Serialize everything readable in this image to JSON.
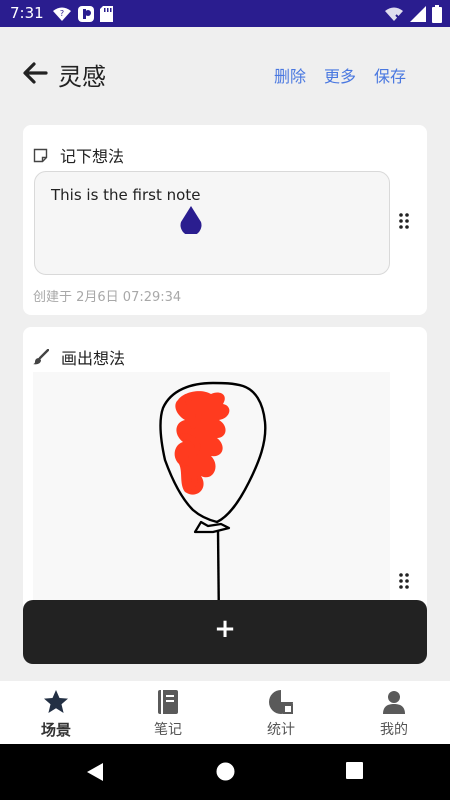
{
  "status_bar": {
    "time": "7:31",
    "left_icons": [
      "wifi-question-icon",
      "app-notification-icon",
      "sd-card-icon"
    ],
    "right_icons": [
      "wifi-off-icon",
      "cell-signal-icon",
      "battery-icon"
    ]
  },
  "header": {
    "title": "灵感",
    "actions": {
      "delete": "删除",
      "more": "更多",
      "save": "保存"
    }
  },
  "text_note": {
    "label": "记下想法",
    "value": "This is the first note",
    "created": "创建于 2月6日 07:29:34"
  },
  "drawing": {
    "label": "画出想法",
    "stroke_color": "#000000",
    "fill_color": "#ff3b1f"
  },
  "add_button": {
    "label": "+"
  },
  "tabs": [
    {
      "label": "场景",
      "icon": "star-icon",
      "active": true
    },
    {
      "label": "笔记",
      "icon": "notebook-icon",
      "active": false
    },
    {
      "label": "统计",
      "icon": "chart-pie-icon",
      "active": false
    },
    {
      "label": "我的",
      "icon": "person-icon",
      "active": false
    }
  ],
  "colors": {
    "status_bar": "#2a1d8f",
    "accent": "#4a78e0",
    "dark": "#222222",
    "tab_icon": "#555555"
  }
}
